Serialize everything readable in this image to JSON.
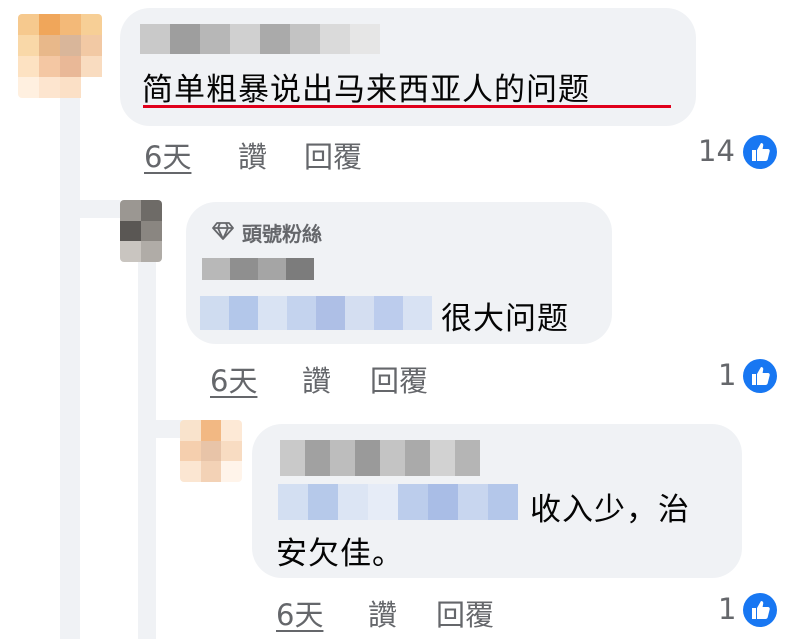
{
  "comments": [
    {
      "author_blurred": true,
      "text": "简单粗暴说出马来西亚人的问题",
      "time": "6天",
      "like_label": "讚",
      "reply_label": "回覆",
      "reaction_count": "14",
      "reaction_icon": "like-icon",
      "highlight_color": "#e0001b"
    },
    {
      "author_blurred": true,
      "badge_icon": "diamond-icon",
      "badge_text": "頭號粉絲",
      "mention_blurred": true,
      "text": "很大问题",
      "time": "6天",
      "like_label": "讚",
      "reply_label": "回覆",
      "reaction_count": "1",
      "reaction_icon": "like-icon"
    },
    {
      "author_blurred": true,
      "mention_blurred": true,
      "text_line1": "收入少，治",
      "text_line2": "安欠佳。",
      "time": "6天",
      "like_label": "讚",
      "reply_label": "回覆",
      "reaction_count": "1",
      "reaction_icon": "like-icon"
    }
  ],
  "colors": {
    "bubble": "#f0f2f5",
    "secondary_text": "#65676b",
    "like_blue": "#1877f2"
  }
}
